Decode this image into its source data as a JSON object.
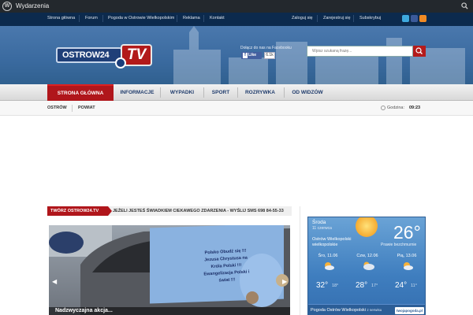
{
  "adminbar": {
    "title": "Wydarzenia",
    "logo_glyph": "W"
  },
  "topnav": {
    "links": [
      "Strona główna",
      "Forum",
      "Pogoda w Ostrowie Wielkopolskim",
      "Reklama",
      "Kontakt"
    ],
    "account": [
      "Zaloguj się",
      "Zarejestruj się",
      "Subskrybuj"
    ],
    "social": [
      "twitter-icon",
      "facebook-icon",
      "rss-icon"
    ]
  },
  "header": {
    "logo_text": "OSTROW24",
    "logo_tv": "TV",
    "fb_text": "Dołącz do nas na Facebooku",
    "fb_like": "Like",
    "fb_count": "6.1k",
    "search_placeholder": "Wpisz szukaną frazę..."
  },
  "mainnav": {
    "items": [
      "STRONA GŁÓWNA",
      "INFORMACJE",
      "WYPADKI",
      "SPORT",
      "ROZRYWKA",
      "OD WIDZÓW"
    ],
    "active_index": 0
  },
  "subnav": {
    "items": [
      "OSTRÓW",
      "POWIAT"
    ],
    "time_label": "Godzina:",
    "time": "09:23"
  },
  "ticker": {
    "label": "TWÓRZ OSTROW24.TV",
    "text": "JEŻELI JESTEŚ ŚWIADKIEM CIEKAWEGO ZDARZENIA - WYŚLIJ SMS 698 84-55-33"
  },
  "slider": {
    "car_text": "Polsko Obudź się !!! Jezusa Chrystusa na Króla Polski !!! Ewangelizacja Polski i świat !!!",
    "caption": "Nadzwyczajna akcja..."
  },
  "weather": {
    "day": "Środa",
    "date": "11 czerwca",
    "location": "Ostrów Wielkopolski wielkopolskie",
    "temp": "26°",
    "condition": "Prawie bezchmurnie",
    "forecast": [
      {
        "label": "Śro, 11.06",
        "high": "32°",
        "low": "18°",
        "icon": "sun-cloud-icon"
      },
      {
        "label": "Czw, 12.06",
        "high": "28°",
        "low": "17°",
        "icon": "cloud-sun-icon"
      },
      {
        "label": "Pią, 13.06",
        "high": "24°",
        "low": "11°",
        "icon": "sun-cloud-icon"
      }
    ],
    "footer_title": "Pogoda Ostrów Wielkopolski",
    "footer_small": "z serwisu",
    "footer_badge": "twojapogoda.pl"
  },
  "colors": {
    "accent_red": "#b0161b",
    "nav_blue": "#0c2a4d",
    "header_blue": "#3a6a9f",
    "weather_blue": "#3f7ebf"
  }
}
